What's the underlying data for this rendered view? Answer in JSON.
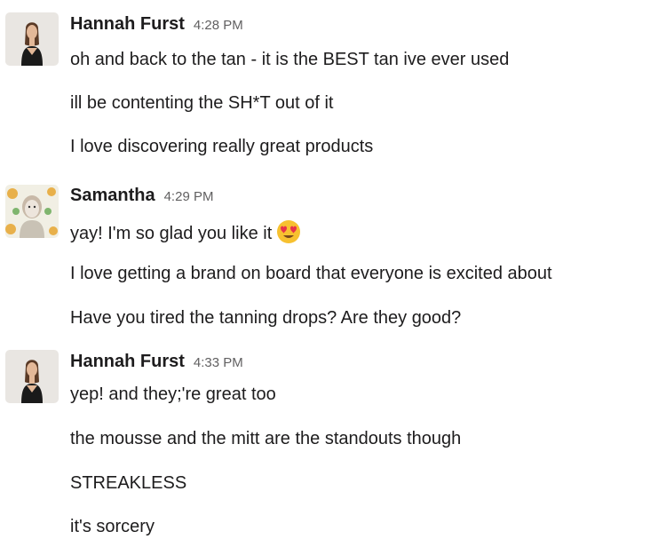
{
  "messages": [
    {
      "author": "Hannah Furst",
      "time": "4:28 PM",
      "avatar": "avatar-hannah",
      "lines": [
        "oh and back to the tan - it is the BEST tan ive ever used",
        "ill be contenting the SH*T out of it",
        "I love discovering really great products"
      ]
    },
    {
      "author": "Samantha",
      "time": "4:29 PM",
      "avatar": "avatar-samantha",
      "lines": [
        "yay!  I'm so glad you like it",
        "I love getting a brand on board that everyone is excited about",
        "Have you tired the tanning drops?  Are they good?"
      ],
      "emoji": "heart-eyes-emoji"
    },
    {
      "author": "Hannah Furst",
      "time": "4:33 PM",
      "avatar": "avatar-hannah",
      "lines": [
        "yep! and they;'re great too",
        "the mousse and the mitt are the standouts though",
        "STREAKLESS",
        "it's sorcery"
      ]
    }
  ]
}
